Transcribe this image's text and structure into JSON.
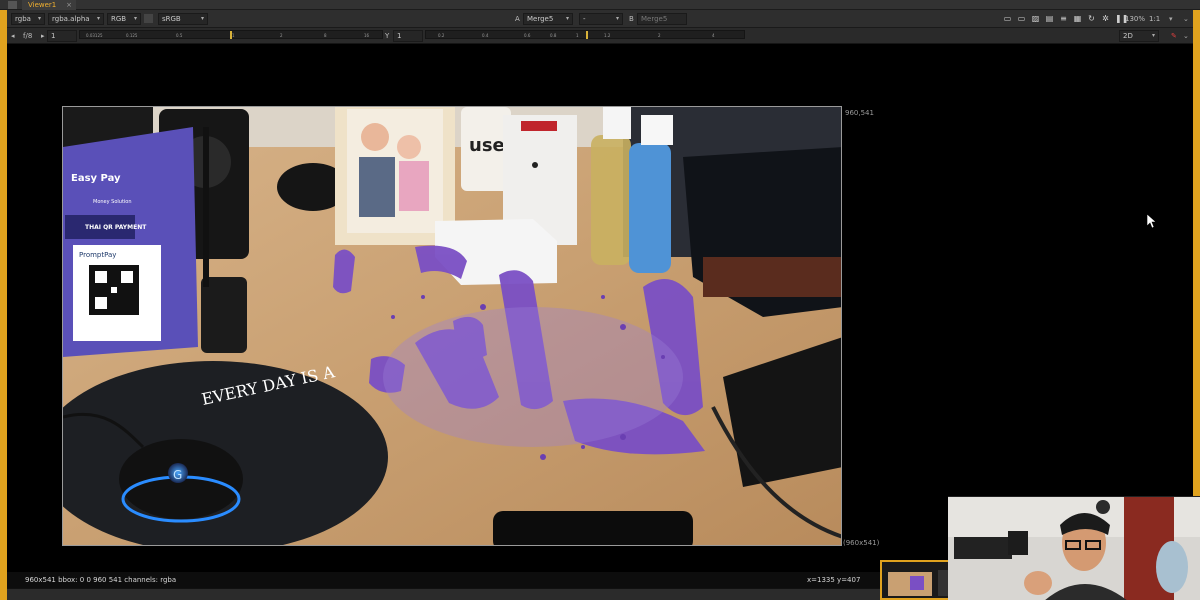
{
  "tabbar": {
    "tab_label": "Viewer1"
  },
  "toolbar": {
    "channels": "rgba",
    "channel_alpha": "rgba.alpha",
    "display_mode": "RGB",
    "colorspace": "sRGB",
    "input_a_label": "A",
    "input_a": "Merge5",
    "wipe_mode": "-",
    "input_b_label": "B",
    "input_b": "Merge5",
    "zoom": "130%",
    "proxy": "1:1"
  },
  "toolbar2": {
    "fstop": "f/8",
    "gain_value": "1",
    "gamma_label": "Y",
    "gamma_value": "1",
    "view_mode": "2D",
    "gain_ticks": [
      "0.03125",
      "0.125",
      "0.5",
      "1",
      "2",
      "8",
      "16"
    ],
    "gamma_ticks": [
      "0.2",
      "0.4",
      "0.6",
      "0.8",
      "1",
      "1.2",
      "2",
      "4"
    ]
  },
  "viewer": {
    "top_right_coord": "960,541",
    "bottom_right_coord": "(960x541)"
  },
  "statusbar": {
    "info": "960x541  bbox: 0 0 960 541  channels: rgba",
    "cursor": "x=1335 y=407"
  },
  "scene": {
    "sign_title": "Easy Pay",
    "sign_subtitle": "Money Solution",
    "qr_label": "THAI QR PAYMENT",
    "promptpay": "PromptPay",
    "mug_text": "use me",
    "mousepad_text": "EVERY DAY IS A",
    "mouse_logo": "G"
  },
  "colors": {
    "accent": "#e0a21e",
    "purple": "#7a4fc4",
    "desk": "#c9a378"
  }
}
